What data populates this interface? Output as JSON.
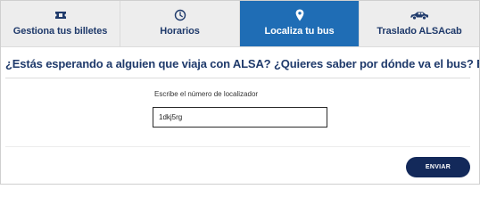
{
  "tabs": [
    {
      "label": "Gestiona tus billetes",
      "icon": "ticket-icon",
      "active": false
    },
    {
      "label": "Horarios",
      "icon": "clock-icon",
      "active": false
    },
    {
      "label": "Localiza tu bus",
      "icon": "location-pin-icon",
      "active": true
    },
    {
      "label": "Traslado ALSAcab",
      "icon": "car-icon",
      "active": false
    }
  ],
  "main": {
    "headline": "¿Estás esperando a alguien que viaja con ALSA? ¿Quieres saber por dónde va el bus? Búscalo aquí.",
    "locator_label": "Escribe el número de localizador",
    "locator_value": "1dkj5rg",
    "submit_label": "ENVIAR"
  },
  "colors": {
    "active_tab": "#1f6db5",
    "tab_text": "#1f3a6b",
    "button": "#13295a",
    "tab_bg": "#ededed"
  }
}
